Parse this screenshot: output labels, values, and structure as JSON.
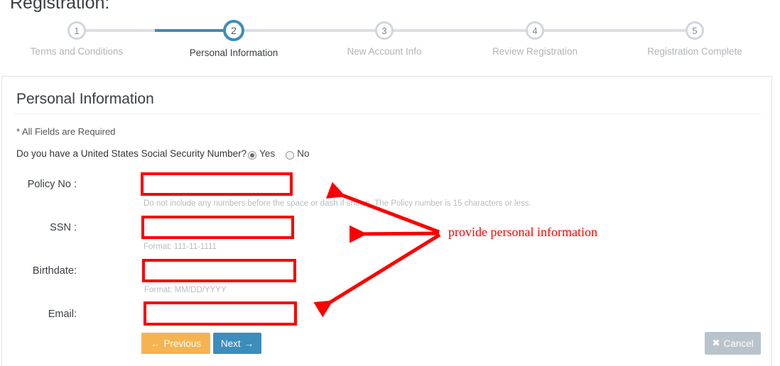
{
  "page": {
    "title": "Registration:"
  },
  "stepper": {
    "steps": [
      {
        "number": "1",
        "label": "Terms and Conditions",
        "state": "inactive"
      },
      {
        "number": "2",
        "label": "Personal Information",
        "state": "active"
      },
      {
        "number": "3",
        "label": "New Account Info",
        "state": "inactive"
      },
      {
        "number": "4",
        "label": "Review Registration",
        "state": "inactive"
      },
      {
        "number": "5",
        "label": "Registration Complete",
        "state": "inactive"
      }
    ],
    "active_color": "#3c8dbc",
    "inactive_color": "#d2d6de"
  },
  "panel": {
    "title": "Personal Information",
    "required_note": "* All Fields are Required",
    "ssn_question": {
      "text": "Do you have a United States Social Security Number?",
      "options": [
        {
          "label": "Yes",
          "selected": true
        },
        {
          "label": "No",
          "selected": false
        }
      ]
    },
    "fields": [
      {
        "label": "Policy No :",
        "value": "",
        "placeholder": "",
        "hint": "Do not include any numbers before the space or dash if shown. The Policy number is 15 characters or less."
      },
      {
        "label": "SSN :",
        "value": "",
        "placeholder": "",
        "hint": "Format: 111-11-1111"
      },
      {
        "label": "Birthdate:",
        "value": "",
        "placeholder": "",
        "hint": "Format: MM/DD/YYYY"
      },
      {
        "label": "Email:",
        "value": "",
        "placeholder": "",
        "hint": ""
      }
    ],
    "buttons": {
      "previous": "Previous",
      "next": "Next",
      "cancel": "Cancel",
      "previous_icon": "arrow-left-icon",
      "next_icon": "arrow-right-icon",
      "cancel_icon": "close-x-icon"
    }
  },
  "annotation": {
    "text": "provide personal information",
    "color": "#fb0000"
  }
}
